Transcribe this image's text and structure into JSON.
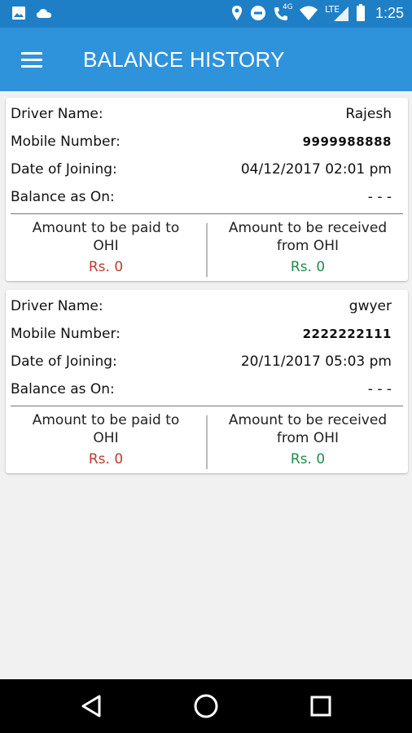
{
  "status_bar": {
    "time": "1:25",
    "icons": [
      "image-icon",
      "cloud-icon",
      "location-icon",
      "do-not-disturb-icon",
      "wifi-calling-icon",
      "wifi-icon",
      "lte-signal-icon",
      "battery-icon"
    ],
    "lte_label": "LTE",
    "fourg_label": "4G"
  },
  "app_bar": {
    "title": "BALANCE HISTORY",
    "menu_icon": "hamburger-menu-icon"
  },
  "cards": [
    {
      "driver_name_label": "Driver Name:",
      "driver_name": "Rajesh",
      "mobile_label": "Mobile Number:",
      "mobile": "9999988888",
      "joining_label": "Date of Joining:",
      "joining": "04/12/2017 02:01 pm",
      "balance_label": "Balance as On:",
      "balance": "- - -",
      "paid_label": "Amount to be paid to OHI",
      "paid_amount": "Rs. 0",
      "received_label": "Amount to be received from OHI",
      "received_amount": "Rs. 0"
    },
    {
      "driver_name_label": "Driver Name:",
      "driver_name": "gwyer",
      "mobile_label": "Mobile Number:",
      "mobile": "2222222111",
      "joining_label": "Date of Joining:",
      "joining": "20/11/2017 05:03 pm",
      "balance_label": "Balance as On:",
      "balance": "- - -",
      "paid_label": "Amount to be paid to OHI",
      "paid_amount": "Rs. 0",
      "received_label": "Amount to be received from OHI",
      "received_amount": "Rs. 0"
    }
  ],
  "nav_bar": {
    "icons": [
      "back-icon",
      "home-icon",
      "recents-icon"
    ]
  },
  "colors": {
    "status_bar": "#1f7fc6",
    "app_bar": "#2f93dc",
    "paid_text": "#c0392b",
    "received_text": "#1e8c4b"
  }
}
